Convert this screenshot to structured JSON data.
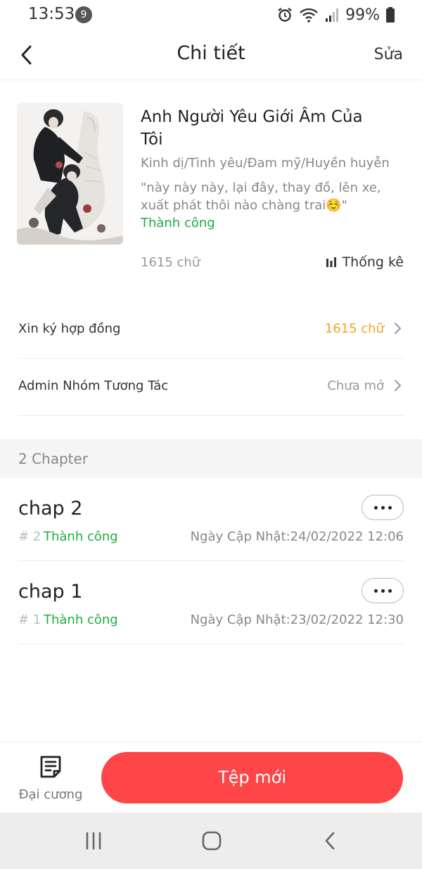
{
  "status_bar": {
    "time": "13:53",
    "notification_count": "9",
    "battery": "99%"
  },
  "header": {
    "title": "Chi tiết",
    "edit_label": "Sửa",
    "back_icon": "chevron-left-icon"
  },
  "book": {
    "title": "Anh Người Yêu Giới Âm Của Tôi",
    "genres": "Kinh dị/Tình yêu/Đam mỹ/Huyền huyễn",
    "description": "\"này này này, lại đây, thay đồ, lên xe, xuất phát thôi nào chàng trai☺️\"",
    "status": "Thành công",
    "word_count": "1615 chữ",
    "stats_label": "Thống kê"
  },
  "settings": [
    {
      "label": "Xin ký hợp đồng",
      "value": "1615 chữ",
      "value_color": "#f5a623"
    },
    {
      "label": "Admin Nhóm Tương Tác",
      "value": "Chưa mở",
      "value_color": "#999999"
    }
  ],
  "chapters_section": {
    "title": "2 Chapter"
  },
  "chapters": [
    {
      "name": "chap 2",
      "number": "# 2",
      "status": "Thành công",
      "updated": "Ngày Cập Nhật:24/02/2022 12:06"
    },
    {
      "name": "chap 1",
      "number": "# 1",
      "status": "Thành công",
      "updated": "Ngày Cập Nhật:23/02/2022 12:30"
    }
  ],
  "bottom_bar": {
    "outline_label": "Đại cương",
    "new_file_label": "Tệp mới"
  },
  "colors": {
    "accent": "#fe4547",
    "success": "#1fae3f",
    "warning": "#f5a623"
  }
}
